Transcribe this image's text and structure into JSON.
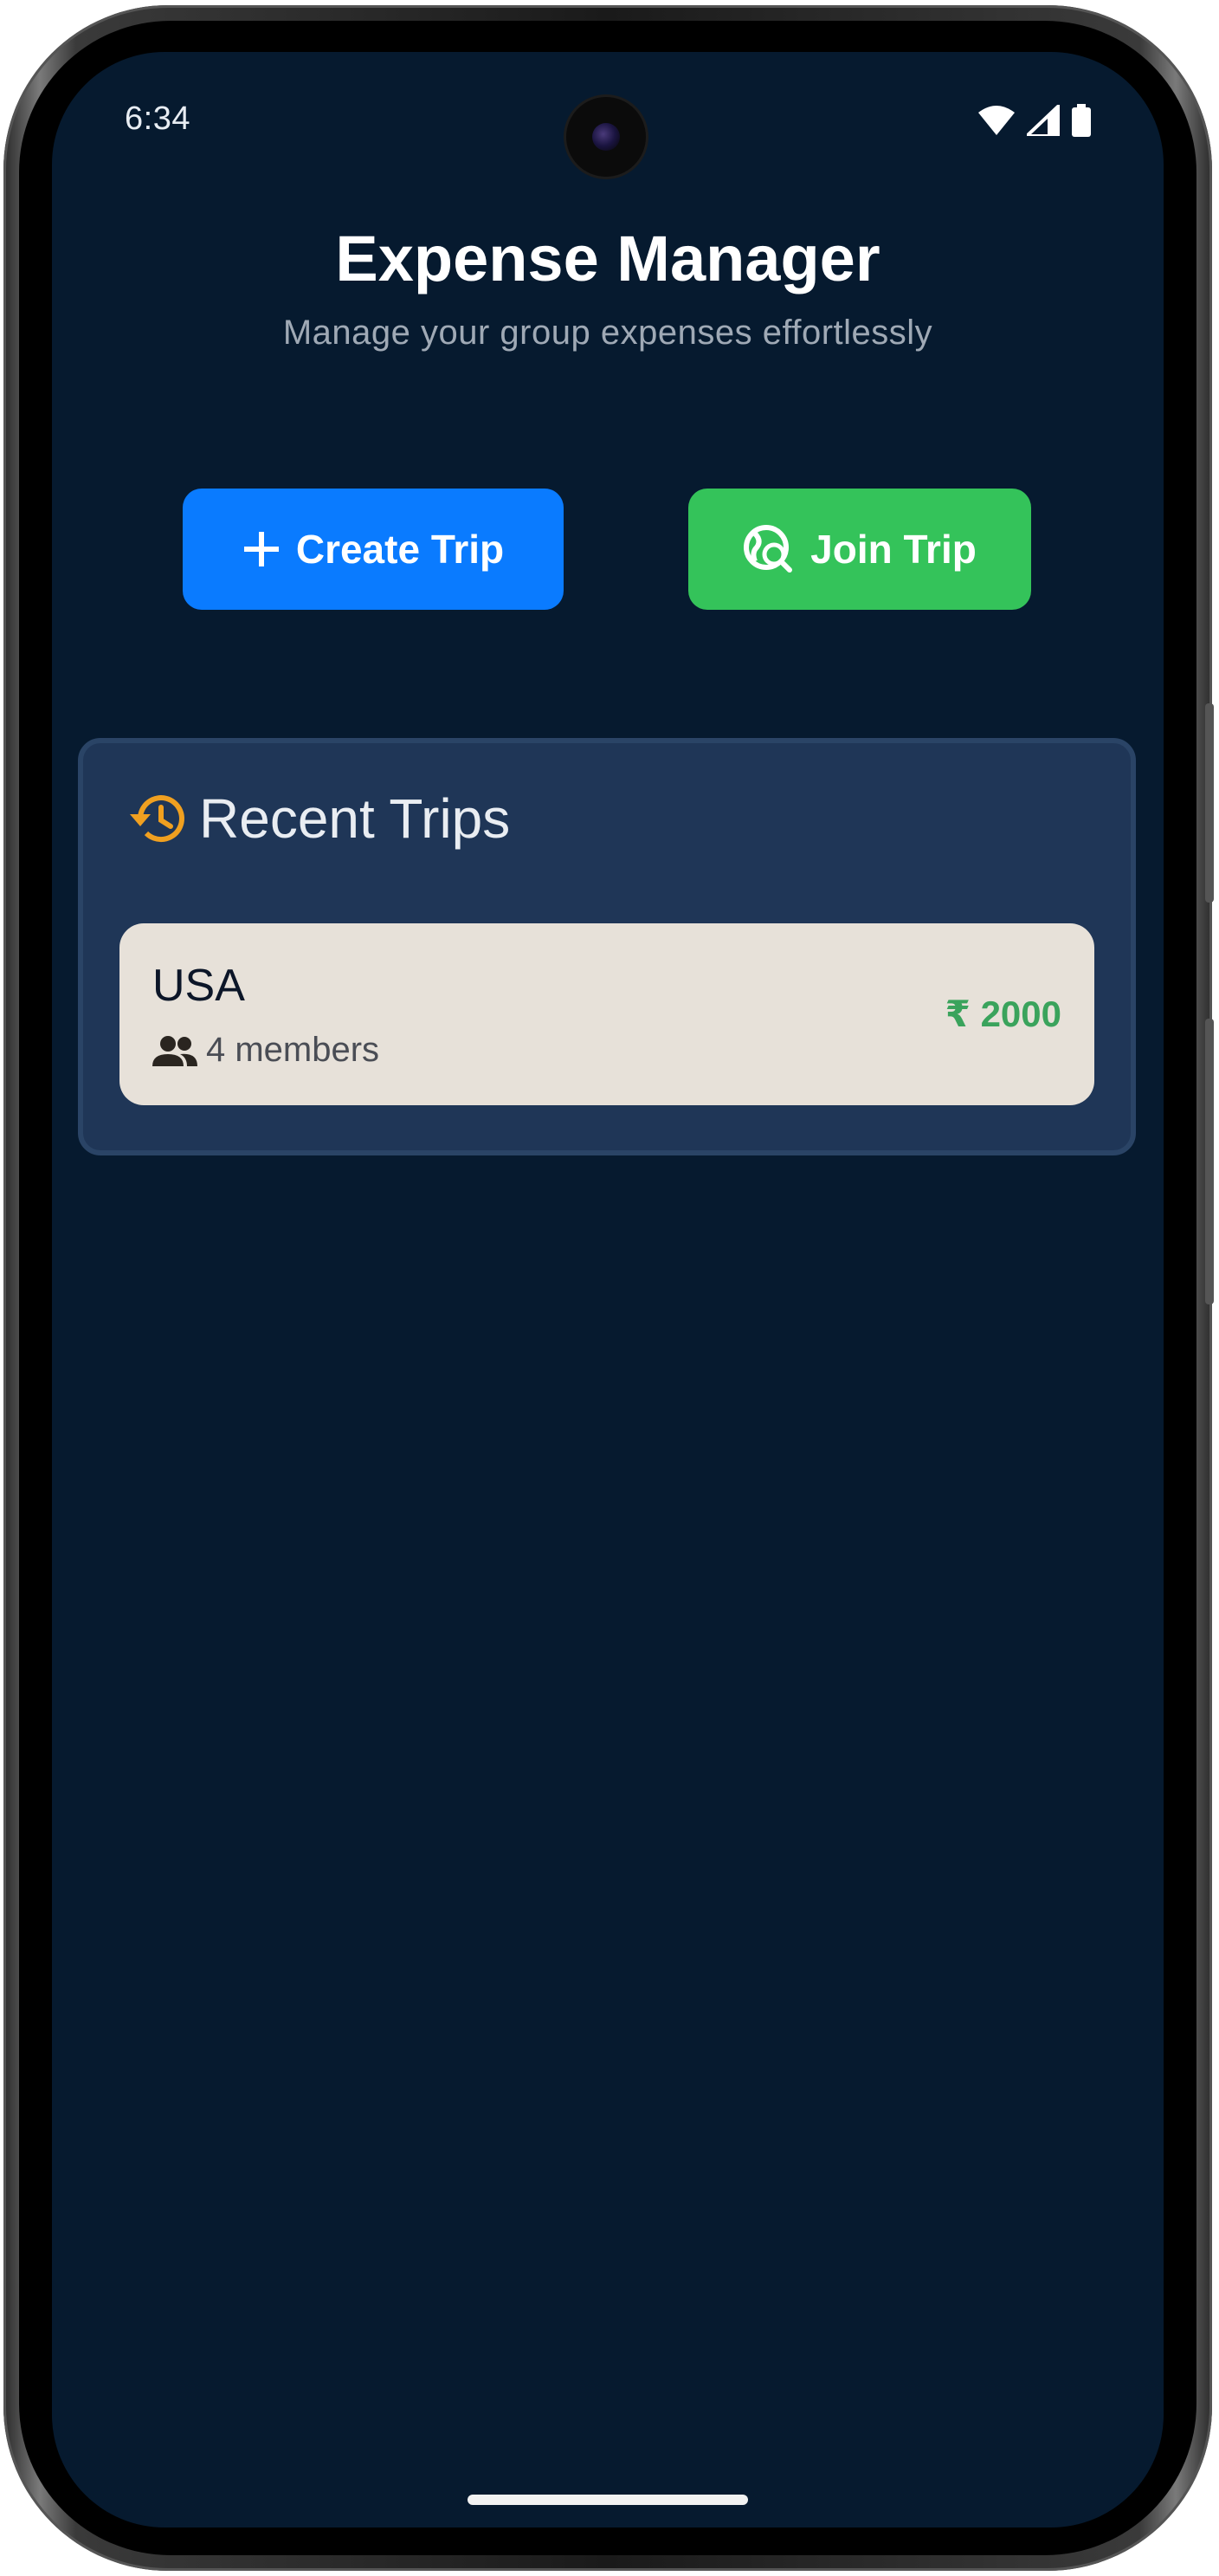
{
  "status_bar": {
    "time": "6:34",
    "icons": [
      "wifi-icon",
      "signal-icon",
      "battery-icon"
    ]
  },
  "header": {
    "title": "Expense Manager",
    "subtitle": "Manage your group expenses effortlessly"
  },
  "actions": {
    "create_label": "Create Trip",
    "create_icon": "plus-icon",
    "join_label": "Join Trip",
    "join_icon": "travel-explore-icon"
  },
  "recent": {
    "title": "Recent Trips",
    "icon": "history-icon",
    "trips": [
      {
        "name": "USA",
        "members": "4 members",
        "amount": "₹ 2000"
      }
    ]
  },
  "colors": {
    "background": "#061a2f",
    "create_button": "#0a7bff",
    "join_button": "#34c35a",
    "panel": "#1f3657",
    "card": "#e7e1d9",
    "accent_orange": "#f0a020",
    "amount_green": "#3aa35c"
  }
}
